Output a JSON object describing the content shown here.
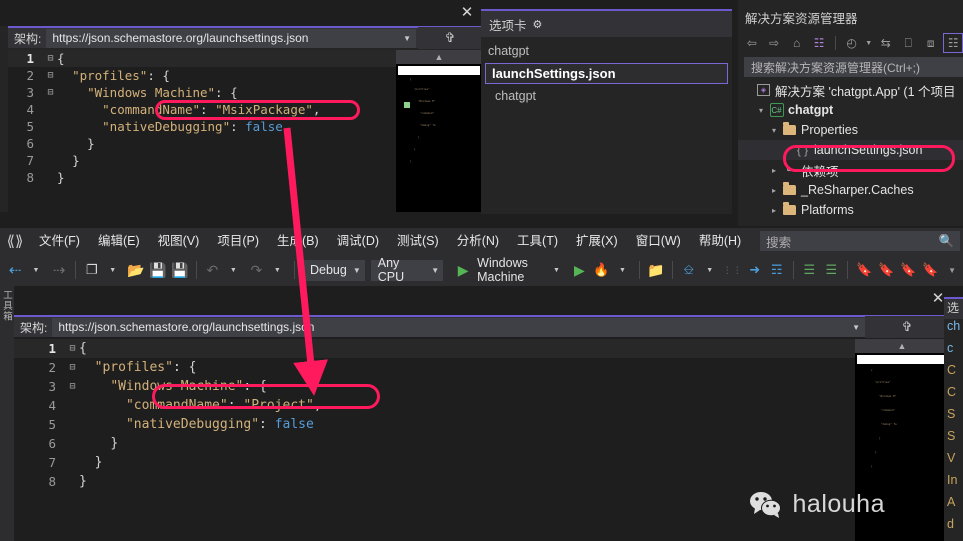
{
  "app": {
    "logo": "visual-studio-logo",
    "menu": [
      "文件(F)",
      "编辑(E)",
      "视图(V)",
      "项目(P)",
      "生成(B)",
      "调试(D)",
      "测试(S)",
      "分析(N)",
      "工具(T)",
      "扩展(X)",
      "窗口(W)",
      "帮助(H)"
    ],
    "search_placeholder": "搜索",
    "search_icon": "magnifier-icon"
  },
  "toolbar": {
    "back_icon": "navigate-back-icon",
    "forward_icon": "navigate-forward-icon",
    "new_item_icon": "new-item-icon",
    "open_icon": "open-file-icon",
    "save_icon": "save-icon",
    "save_all_icon": "save-all-icon",
    "undo_icon": "undo-icon",
    "redo_icon": "redo-icon",
    "configuration": "Debug",
    "platform": "Any CPU",
    "start_target": "Windows Machine",
    "run_icon": "play-icon",
    "hot_reload_icon": "hot-reload-icon",
    "folder_search_icon": "folder-search-icon",
    "window_icon": "window-layout-icon",
    "pointer_icon": "select-element-icon",
    "doc_icon": "document-outline-icon",
    "indent_icon": "indent-icon",
    "outdent_icon": "outdent-icon",
    "bookmark_icon": "bookmark-icon",
    "bookmark_prev_icon": "bookmark-prev-icon",
    "bookmark_next_icon": "bookmark-next-icon",
    "bookmark_clear_icon": "bookmark-clear-icon",
    "overflow_icon": "toolbar-overflow-icon"
  },
  "upper_editor": {
    "close_icon": "close-icon",
    "schema_label": "架构:",
    "schema_value": "https://json.schemastore.org/launchsettings.json",
    "split_icon": "split-view-icon",
    "scroll_up_icon": "scroll-up-icon",
    "lines": [
      {
        "n": "1",
        "fold": "⊟",
        "indent": 0,
        "text": "{"
      },
      {
        "n": "2",
        "fold": "⊟",
        "indent": 1,
        "text": "\"profiles\": {"
      },
      {
        "n": "3",
        "fold": "⊟",
        "indent": 2,
        "text": "\"Windows Machine\": {"
      },
      {
        "n": "4",
        "fold": "",
        "indent": 3,
        "text": "\"commandName\": \"MsixPackage\","
      },
      {
        "n": "5",
        "fold": "",
        "indent": 3,
        "text": "\"nativeDebugging\": false"
      },
      {
        "n": "6",
        "fold": "",
        "indent": 2,
        "text": "}"
      },
      {
        "n": "7",
        "fold": "",
        "indent": 1,
        "text": "}"
      },
      {
        "n": "8",
        "fold": "",
        "indent": 0,
        "text": "}"
      }
    ],
    "highlighted_line": "\"commandName\": \"MsixPackage\","
  },
  "lower_editor": {
    "close_icon": "close-icon",
    "schema_label": "架构:",
    "schema_value": "https://json.schemastore.org/launchsettings.json",
    "split_icon": "split-view-icon",
    "scroll_up_icon": "scroll-up-icon",
    "lines": [
      {
        "n": "1",
        "fold": "⊟",
        "indent": 0,
        "text": "{"
      },
      {
        "n": "2",
        "fold": "⊟",
        "indent": 1,
        "text": "\"profiles\": {"
      },
      {
        "n": "3",
        "fold": "⊟",
        "indent": 2,
        "text": "\"Windows Machine\": {"
      },
      {
        "n": "4",
        "fold": "",
        "indent": 3,
        "text": "\"commandName\": \"Project\","
      },
      {
        "n": "5",
        "fold": "",
        "indent": 3,
        "text": "\"nativeDebugging\": false"
      },
      {
        "n": "6",
        "fold": "",
        "indent": 2,
        "text": "}"
      },
      {
        "n": "7",
        "fold": "",
        "indent": 1,
        "text": "}"
      },
      {
        "n": "8",
        "fold": "",
        "indent": 0,
        "text": "}"
      }
    ],
    "highlighted_line": "\"commandName\": \"Project\","
  },
  "tabs_panel": {
    "title": "选项卡",
    "gear_icon": "gear-icon",
    "items": [
      {
        "label": "chatgpt",
        "selected": false,
        "indent": false
      },
      {
        "label": "launchSettings.json",
        "selected": true,
        "indent": false
      },
      {
        "label": "chatgpt",
        "selected": false,
        "indent": true
      }
    ]
  },
  "solution_explorer": {
    "title": "解决方案资源管理器",
    "toolbar_icons": [
      "back-icon",
      "forward-icon",
      "home-icon",
      "sync-with-active-document-icon",
      "pending-changes-icon",
      "chevron-down-icon",
      "switch-views-icon",
      "collapse-all-icon",
      "properties-window-icon",
      "show-all-files-icon"
    ],
    "search_placeholder": "搜索解决方案资源管理器(Ctrl+;)",
    "tree": [
      {
        "label": "解决方案 'chatgpt.App' (1 个项目",
        "icon": "solution-icon",
        "indent": 0,
        "arrow": "",
        "bold": false,
        "selected": false
      },
      {
        "label": "chatgpt",
        "icon": "csharp-project-icon",
        "indent": 1,
        "arrow": "▾",
        "bold": true,
        "selected": false
      },
      {
        "label": "Properties",
        "icon": "properties-folder-icon",
        "indent": 2,
        "arrow": "▾",
        "bold": false,
        "selected": false
      },
      {
        "label": "launchSettings.json",
        "icon": "json-file-icon",
        "indent": 3,
        "arrow": "",
        "bold": false,
        "selected": true
      },
      {
        "label": "依赖项",
        "icon": "dependencies-icon",
        "indent": 2,
        "arrow": "▸",
        "bold": false,
        "selected": false
      },
      {
        "label": "_ReSharper.Caches",
        "icon": "folder-icon",
        "indent": 2,
        "arrow": "▸",
        "bold": false,
        "selected": false
      },
      {
        "label": "Platforms",
        "icon": "folder-icon",
        "indent": 2,
        "arrow": "▸",
        "bold": false,
        "selected": false
      }
    ]
  },
  "side_toolbox": {
    "label": "工具箱"
  },
  "right_cut_panel": {
    "title": "选",
    "rows": [
      "ch",
      "c",
      "C",
      "C",
      "S",
      "S",
      "V",
      "In",
      "A",
      "d"
    ]
  },
  "watermark": {
    "icon": "wechat-icon",
    "text": "halouha"
  },
  "annotations": {
    "arrow_color": "#ff1a5e",
    "box_color": "#ff1a5e",
    "note": "red callout boxes around commandName lines and launchSettings.json tree node with arrow from upper to lower editor"
  },
  "colors": {
    "accent": "#6a5acd",
    "background": "#1e1e1e",
    "panel": "#252526",
    "chrome": "#2d2d30",
    "string": "#d3b17a",
    "boolean": "#569cd6",
    "highlight": "#ff1a5e"
  }
}
